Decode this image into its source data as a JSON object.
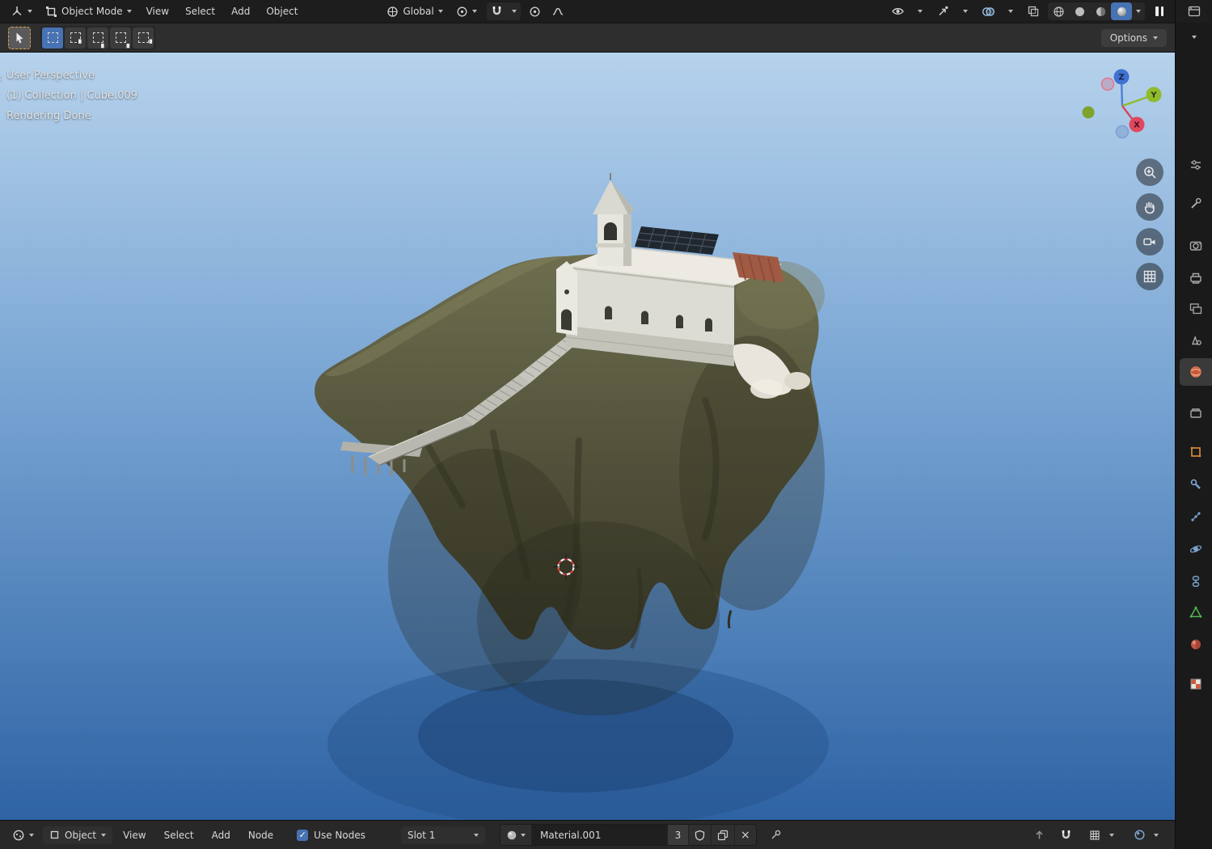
{
  "topbar": {
    "mode_label": "Object Mode",
    "menus": [
      "View",
      "Select",
      "Add",
      "Object"
    ],
    "orientation_label": "Global"
  },
  "toolrow": {
    "options_label": "Options"
  },
  "viewport": {
    "perspective_label": "User Perspective",
    "breadcrumb": "(1) Collection | Cube.009",
    "status": "Rendering Done",
    "gizmo": {
      "x": "X",
      "y": "Y",
      "z": "Z"
    }
  },
  "bottombar": {
    "shader_type_label": "Object",
    "menus": [
      "View",
      "Select",
      "Add",
      "Node"
    ],
    "use_nodes_label": "Use Nodes",
    "slot_label": "Slot 1",
    "material_name": "Material.001",
    "material_users": "3"
  },
  "icons": {
    "check": "✓",
    "close": "×"
  },
  "colors": {
    "accent": "#4772b3",
    "sky_top": "#b6d2ec",
    "sky_bottom": "#2e63a4",
    "island": "#55553d",
    "active_tool_outline": "#d9a44a"
  }
}
